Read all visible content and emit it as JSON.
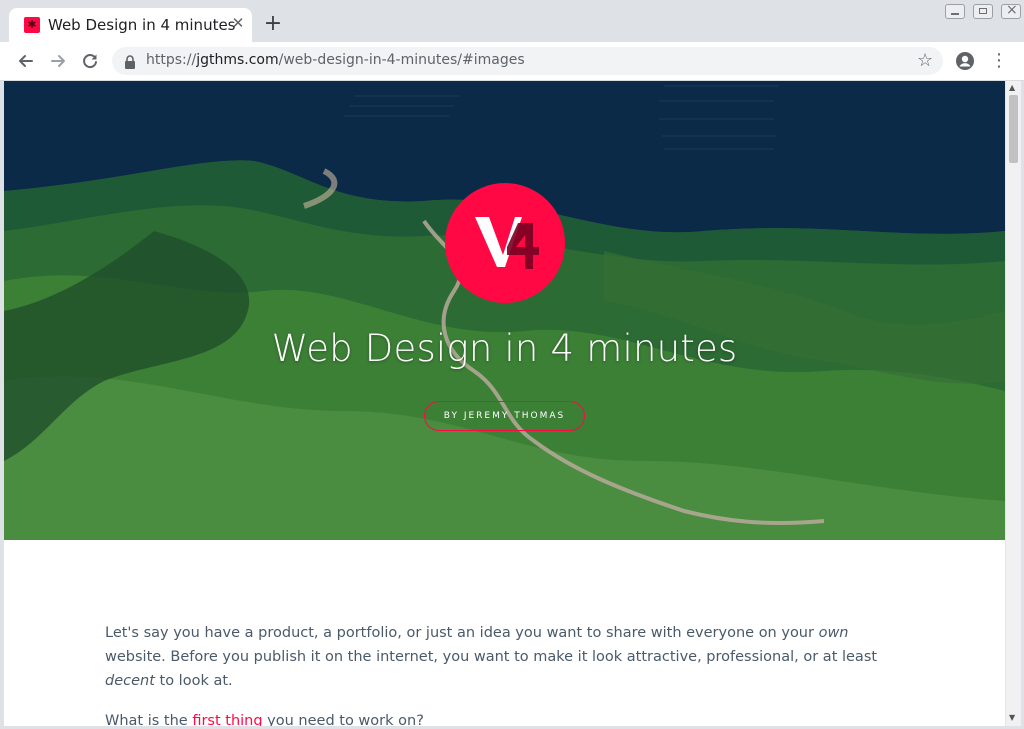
{
  "tab": {
    "title": "Web Design in 4 minutes",
    "close_icon": "close-icon",
    "new_tab_icon": "plus-icon"
  },
  "toolbar": {
    "url_scheme": "https://",
    "url_host": "jgthms.com",
    "url_path": "/web-design-in-4-minutes/#images"
  },
  "hero": {
    "title": "Web Design in 4 minutes",
    "author_button": "BY JEREMY THOMAS",
    "accent_color": "#ff0844"
  },
  "article": {
    "p1_a": "Let's say you have a product, a portfolio, or just an idea you want to share with everyone on your ",
    "p1_em1": "own",
    "p1_b": " website. Before you publish it on the internet, you want to make it look attractive, professional, or at least ",
    "p1_em2": "decent",
    "p1_c": " to look at.",
    "p2_a": "What is the ",
    "p2_link": "first thing",
    "p2_b": " you need to work on?"
  }
}
